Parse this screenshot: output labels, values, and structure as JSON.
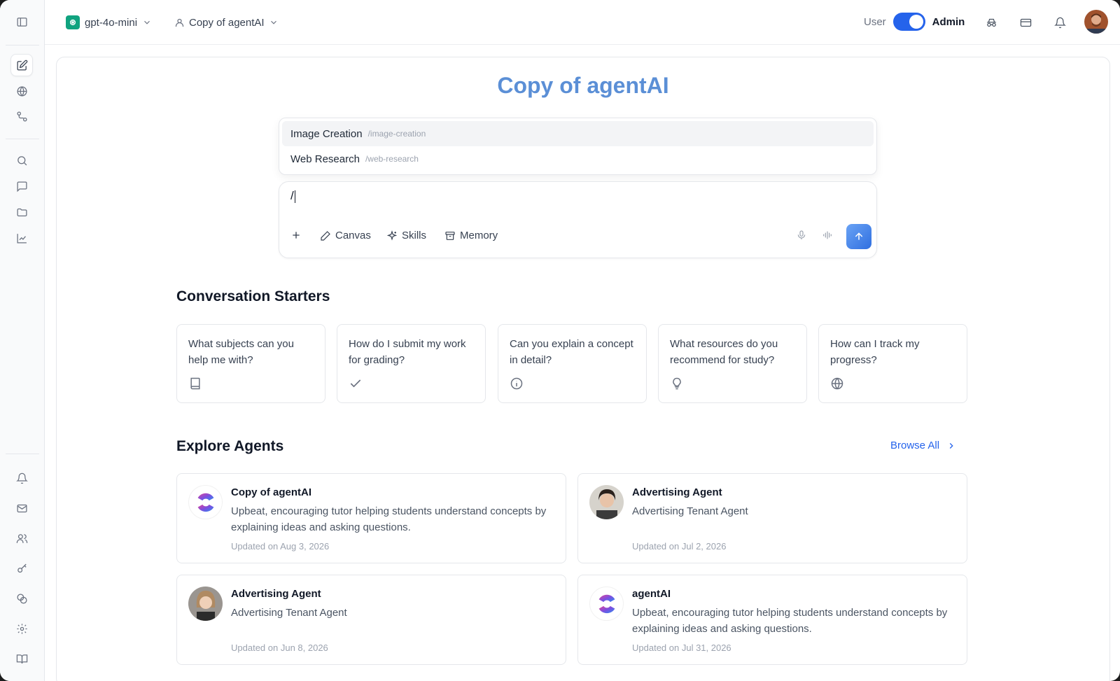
{
  "header": {
    "model_name": "gpt-4o-mini",
    "agent_name": "Copy of agentAI",
    "role_user": "User",
    "role_admin": "Admin"
  },
  "main": {
    "title": "Copy of agentAI",
    "suggestions": [
      {
        "label": "Image Creation",
        "command": "/image-creation"
      },
      {
        "label": "Web Research",
        "command": "/web-research"
      }
    ],
    "composer": {
      "value": "/",
      "tools": {
        "canvas": "Canvas",
        "skills": "Skills",
        "memory": "Memory"
      }
    },
    "starters_heading": "Conversation Starters",
    "starters": [
      {
        "text": "What subjects can you help me with?",
        "icon": "book-icon"
      },
      {
        "text": "How do I submit my work for grading?",
        "icon": "check-icon"
      },
      {
        "text": "Can you explain a concept in detail?",
        "icon": "info-icon"
      },
      {
        "text": "What resources do you recommend for study?",
        "icon": "lightbulb-icon"
      },
      {
        "text": "How can I track my progress?",
        "icon": "globe-icon"
      }
    ],
    "explore_heading": "Explore Agents",
    "browse_all": "Browse All",
    "agents": [
      {
        "name": "Copy of agentAI",
        "description": "Upbeat, encouraging tutor helping students understand concepts by explaining ideas and asking questions.",
        "updated": "Updated on Aug 3, 2026"
      },
      {
        "name": "Advertising Agent",
        "description": "Advertising Tenant Agent",
        "updated": "Updated on Jul 2, 2026"
      },
      {
        "name": "Advertising Agent",
        "description": "Advertising Tenant Agent",
        "updated": "Updated on Jun 8, 2026"
      },
      {
        "name": "agentAI",
        "description": "Upbeat, encouraging tutor helping students understand concepts by explaining ideas and asking questions.",
        "updated": "Updated on Jul 31, 2026"
      }
    ]
  },
  "colors": {
    "accent": "#2563eb",
    "title": "#5b8fd6",
    "model_logo": "#10a37f"
  }
}
